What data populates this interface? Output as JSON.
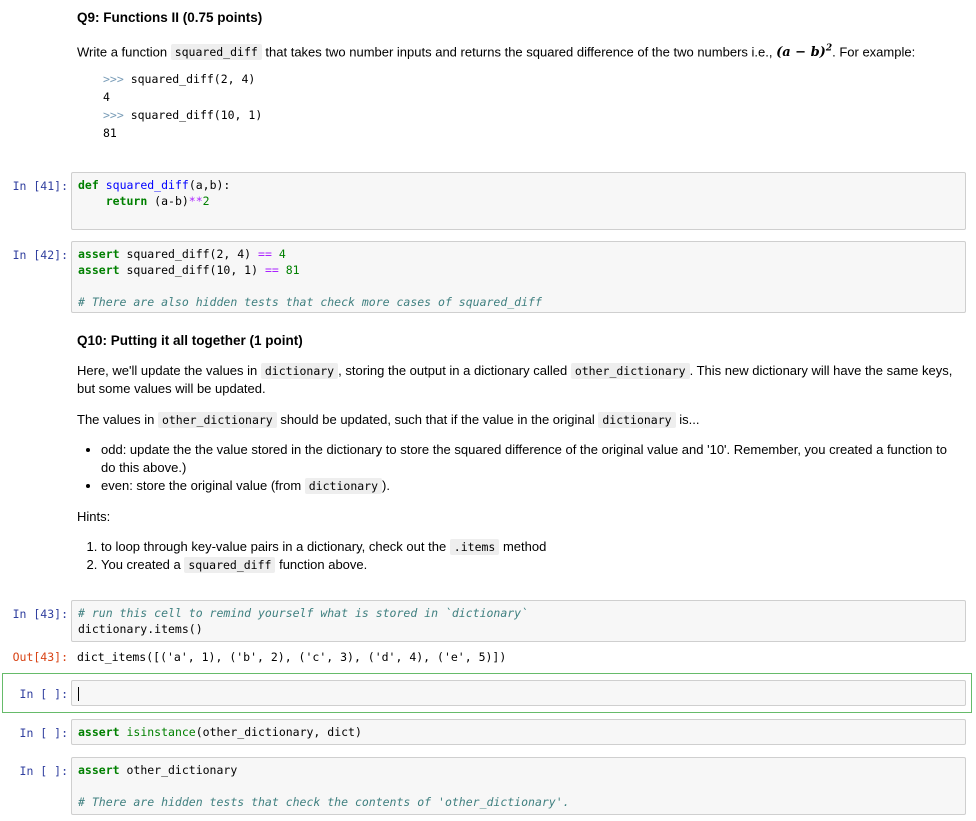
{
  "q9": {
    "title": "Q9: Functions II (0.75 points)",
    "intro_before": "Write a function ",
    "intro_code": "squared_diff",
    "intro_after": " that takes two number inputs and returns the squared difference of the two numbers i.e., ",
    "formula": "(a − b)",
    "formula_exp": "2",
    "intro_tail": ". For example:",
    "examples": [
      {
        "prompt": ">>>",
        "call": " squared_diff(2, 4)",
        "result": "4"
      },
      {
        "prompt": ">>>",
        "call": " squared_diff(10, 1)",
        "result": "81"
      }
    ]
  },
  "cells": {
    "c41": {
      "prompt": "In [41]:",
      "line1_kw": "def",
      "line1_fn": "squared_diff",
      "line1_rest": "(a,b):",
      "line2_kw": "return",
      "line2_rest": " (a-b)",
      "line2_op": "**",
      "line2_num": "2"
    },
    "c42": {
      "prompt": "In [42]:",
      "l1_kw": "assert",
      "l1_rest": " squared_diff(2, 4) ",
      "l1_op": "==",
      "l1_num": "4",
      "l2_kw": "assert",
      "l2_rest": " squared_diff(10, 1) ",
      "l2_op": "==",
      "l2_num": "81",
      "comment": "# There are also hidden tests that check more cases of squared_diff"
    },
    "c43": {
      "prompt": "In [43]:",
      "comment": "# run this cell to remind yourself what is stored in `dictionary`",
      "code": "dictionary.items()",
      "out_prompt": "Out[43]:",
      "output": "dict_items([('a', 1), ('b', 2), ('c', 3), ('d', 4), ('e', 5)])"
    },
    "empty": {
      "prompt": "In [ ]:"
    },
    "isinst": {
      "prompt": "In [ ]:",
      "kw": "assert",
      "fn": "isinstance",
      "rest": "(other_dictionary, dict)"
    },
    "last": {
      "prompt": "In [ ]:",
      "kw": "assert",
      "rest": " other_dictionary",
      "comment": "# There are hidden tests that check the contents of 'other_dictionary'."
    }
  },
  "q10": {
    "title": "Q10: Putting it all together (1 point)",
    "p1_a": "Here, we'll update the values in ",
    "p1_code1": "dictionary",
    "p1_b": ", storing the output in a dictionary called ",
    "p1_code2": "other_dictionary",
    "p1_c": ". This new dictionary will have the same keys, but some values will be updated.",
    "p2_a": "The values in ",
    "p2_code1": "other_dictionary",
    "p2_b": " should be updated, such that if the value in the original ",
    "p2_code2": "dictionary",
    "p2_c": " is...",
    "bullet1": "odd: update the the value stored in the dictionary to store the squared difference of the original value and '10'. Remember, you created a function to do this above.)",
    "bullet2_a": "even: store the original value (from ",
    "bullet2_code": "dictionary",
    "bullet2_b": ").",
    "hints_label": "Hints:",
    "hint1_a": "to loop through key-value pairs in a dictionary, check out the ",
    "hint1_code": ".items",
    "hint1_b": " method",
    "hint2_a": "You created a ",
    "hint2_code": "squared_diff",
    "hint2_b": " function above."
  }
}
